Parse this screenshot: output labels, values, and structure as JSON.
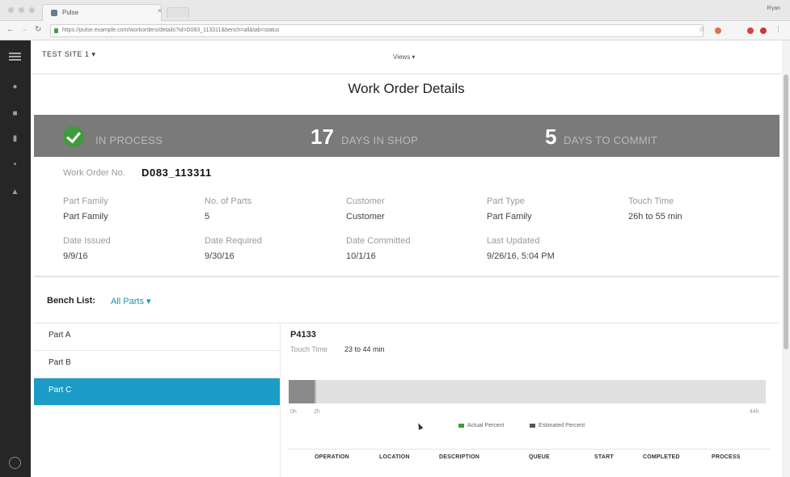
{
  "browser": {
    "tab_title": "Pulse",
    "user_label": "Ryan",
    "url": "https://pulse.example.com/workorders/details?id=D083_113311&bench=all&tab=status"
  },
  "app": {
    "site_selector": "TEST SITE 1 ▾",
    "center_selector": "Views ▾"
  },
  "page": {
    "title": "Work Order Details"
  },
  "status": {
    "state": "IN PROCESS",
    "days_in_shop": "17",
    "days_in_shop_label": "DAYS IN SHOP",
    "days_to_commit": "5",
    "days_to_commit_label": "DAYS TO COMMIT"
  },
  "work_order": {
    "number_label": "Work Order No.",
    "number_value": "D083_113311",
    "fields": [
      {
        "label": "Part Family",
        "value": "Part Family"
      },
      {
        "label": "No. of Parts",
        "value": "5"
      },
      {
        "label": "Customer",
        "value": "Customer"
      },
      {
        "label": "Part Type",
        "value": "Part Family"
      },
      {
        "label": "Touch Time",
        "value": "26h to 55 min"
      },
      {
        "label": "Date Issued",
        "value": "9/9/16"
      },
      {
        "label": "Date Required",
        "value": "9/30/16"
      },
      {
        "label": "Date Committed",
        "value": "10/1/16"
      },
      {
        "label": "Last Updated",
        "value": "9/26/16, 5:04 PM"
      }
    ]
  },
  "bench": {
    "label": "Bench List:",
    "value": "All Parts ▾"
  },
  "parts": [
    {
      "name": "Part A"
    },
    {
      "name": "Part B"
    },
    {
      "name": "Part C"
    }
  ],
  "part_detail": {
    "title": "P4133",
    "touch_label": "Touch Time",
    "touch_value": "23 to 44 min",
    "progress_fraction": 0.057,
    "tick_start": "0h",
    "tick_mid": "2h",
    "tick_end": "44h",
    "legend_actual": "Actual Percent",
    "legend_estimated": "Estimated Percent",
    "columns": [
      "OPERATION",
      "LOCATION",
      "DESCRIPTION",
      "QUEUE",
      "START",
      "COMPLETED",
      "PROCESS"
    ]
  },
  "colors": {
    "accent": "#1b9cc6",
    "status_band": "#7a7a7a",
    "success": "#3e9b3e",
    "legend_actual": "#3e9b3e",
    "legend_estimated": "#555555"
  }
}
